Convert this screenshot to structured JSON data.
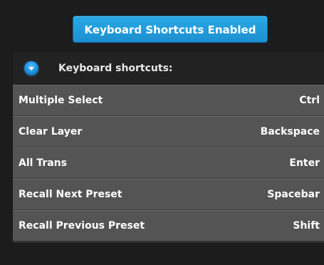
{
  "enable_button": {
    "label": "Keyboard Shortcuts Enabled",
    "color": "#1e9ad9"
  },
  "panel": {
    "title": "Keyboard shortcuts:",
    "toggle_icon": "chevron-down-icon",
    "shortcuts": [
      {
        "action": "Multiple Select",
        "key": "Ctrl"
      },
      {
        "action": "Clear Layer",
        "key": "Backspace"
      },
      {
        "action": "All Trans",
        "key": "Enter"
      },
      {
        "action": "Recall Next Preset",
        "key": "Spacebar"
      },
      {
        "action": "Recall Previous Preset",
        "key": "Shift"
      }
    ]
  }
}
